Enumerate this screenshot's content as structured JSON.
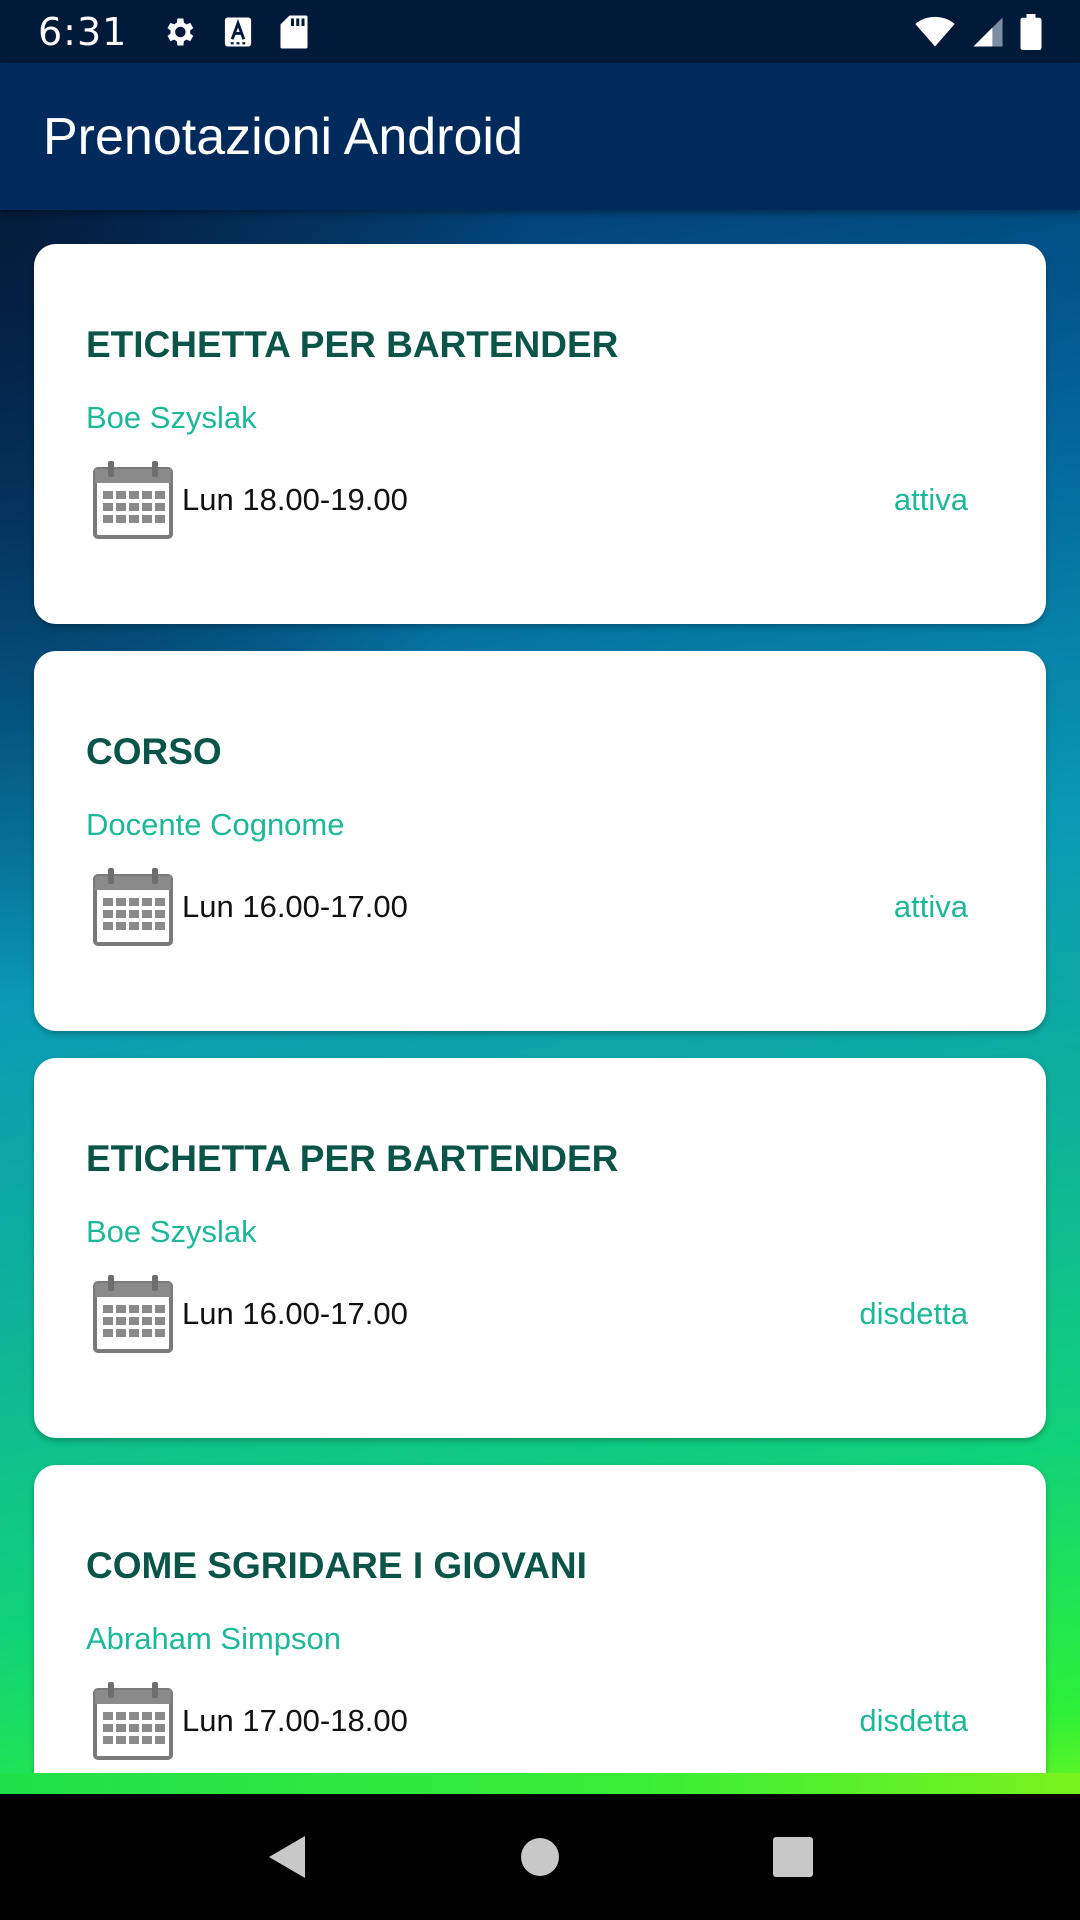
{
  "status_bar": {
    "time": "6:31",
    "icons_left": [
      "settings-icon",
      "text-format-icon",
      "sd-card-icon"
    ],
    "icons_right": [
      "wifi-icon",
      "signal-icon",
      "battery-icon"
    ]
  },
  "app_bar": {
    "title": "Prenotazioni Android"
  },
  "bookings": [
    {
      "title": "ETICHETTA PER BARTENDER",
      "teacher": "Boe Szyslak",
      "time": "Lun 18.00-19.00",
      "status": "attiva"
    },
    {
      "title": "CORSO",
      "teacher": "Docente Cognome",
      "time": "Lun 16.00-17.00",
      "status": "attiva"
    },
    {
      "title": "ETICHETTA PER BARTENDER",
      "teacher": "Boe Szyslak",
      "time": "Lun 16.00-17.00",
      "status": "disdetta"
    },
    {
      "title": "COME SGRIDARE I GIOVANI",
      "teacher": "Abraham Simpson",
      "time": "Lun 17.00-18.00",
      "status": "disdetta"
    }
  ],
  "nav_bar": {
    "buttons": [
      "back-icon",
      "home-icon",
      "recents-icon"
    ]
  },
  "colors": {
    "status_bar_bg": "#011a3a",
    "app_bar_bg": "#012a5c",
    "title_text": "#0a5448",
    "accent_text": "#1db897"
  }
}
